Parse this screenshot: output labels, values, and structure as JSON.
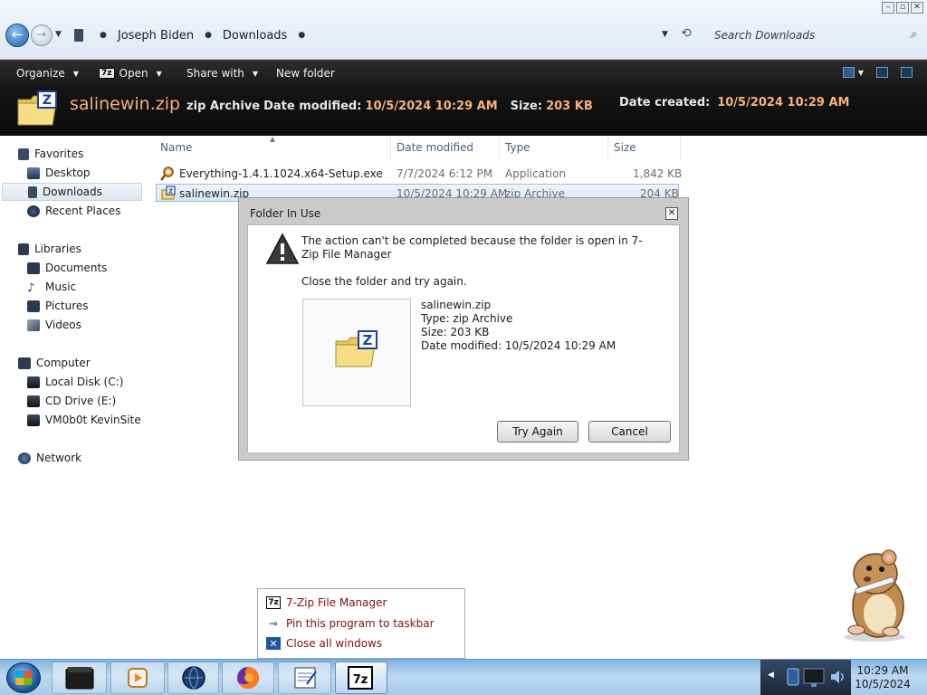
{
  "window": {
    "breadcrumb": [
      "Joseph Biden",
      "Downloads"
    ],
    "search_placeholder": "Search Downloads"
  },
  "toolbar": {
    "organize": "Organize",
    "open": "Open",
    "share_with": "Share with",
    "new_folder": "New folder"
  },
  "details": {
    "file_name": "salinewin.zip",
    "type": "zip Archive",
    "date_modified_label": "Date modified:",
    "date_modified": "10/5/2024 10:29 AM",
    "size_label": "Size:",
    "size": "203 KB",
    "date_created_label": "Date created:",
    "date_created": "10/5/2024 10:29 AM"
  },
  "nav": {
    "favorites": "Favorites",
    "desktop": "Desktop",
    "downloads": "Downloads",
    "recent_places": "Recent Places",
    "libraries": "Libraries",
    "documents": "Documents",
    "music": "Music",
    "pictures": "Pictures",
    "videos": "Videos",
    "computer": "Computer",
    "local_disk": "Local Disk (C:)",
    "cd_drive": "CD Drive (E:)",
    "network_location": "VM0b0t KevinSite",
    "network": "Network"
  },
  "columns": {
    "name": "Name",
    "date_modified": "Date modified",
    "type": "Type",
    "size": "Size"
  },
  "files": [
    {
      "name": "Everything-1.4.1.1024.x64-Setup.exe",
      "date": "7/7/2024 6:12 PM",
      "type": "Application",
      "size": "1,842 KB"
    },
    {
      "name": "salinewin.zip",
      "date": "10/5/2024 10:29 AM",
      "type": "zip Archive",
      "size": "204 KB"
    }
  ],
  "dialog": {
    "title": "Folder In Use",
    "message": "The action can't be completed because the folder is open in 7-Zip File Manager",
    "sub": "Close the folder and try again.",
    "file_name": "salinewin.zip",
    "file_type": "Type: zip Archive",
    "file_size": "Size: 203 KB",
    "file_modified": "Date modified: 10/5/2024 10:29 AM",
    "try_again": "Try Again",
    "cancel": "Cancel"
  },
  "jumplist": {
    "app": "7-Zip File Manager",
    "pin": "Pin this program to taskbar",
    "close_all": "Close all windows"
  },
  "clock": {
    "time": "10:29 AM",
    "date": "10/5/2024"
  },
  "colors": {
    "detail_accent": "#f6b27a",
    "jumplist_text": "#7d1111",
    "zip_badge": "#1b3fa8"
  }
}
